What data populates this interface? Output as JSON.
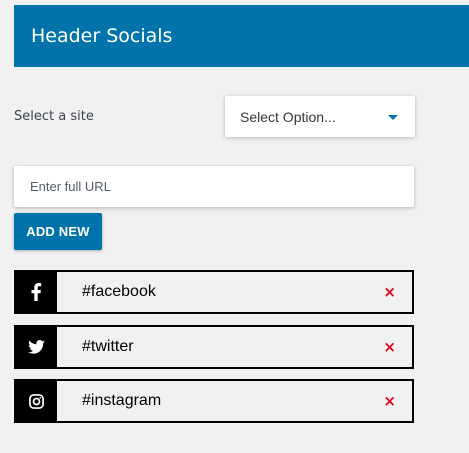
{
  "header": {
    "title": "Header Socials"
  },
  "site_select": {
    "label": "Select a site",
    "selected": "Select Option..."
  },
  "url_field": {
    "placeholder": "Enter full URL",
    "value": ""
  },
  "add_button": {
    "label": "ADD NEW"
  },
  "socials": [
    {
      "icon": "facebook-icon",
      "handle": "#facebook",
      "remove": "×"
    },
    {
      "icon": "twitter-icon",
      "handle": "#twitter",
      "remove": "×"
    },
    {
      "icon": "instagram-icon",
      "handle": "#instagram",
      "remove": "×"
    }
  ],
  "colors": {
    "brand": "#0073aa",
    "page_background": "#f1f1f1",
    "icon_cell": "#000000",
    "remove": "#e2001a"
  }
}
